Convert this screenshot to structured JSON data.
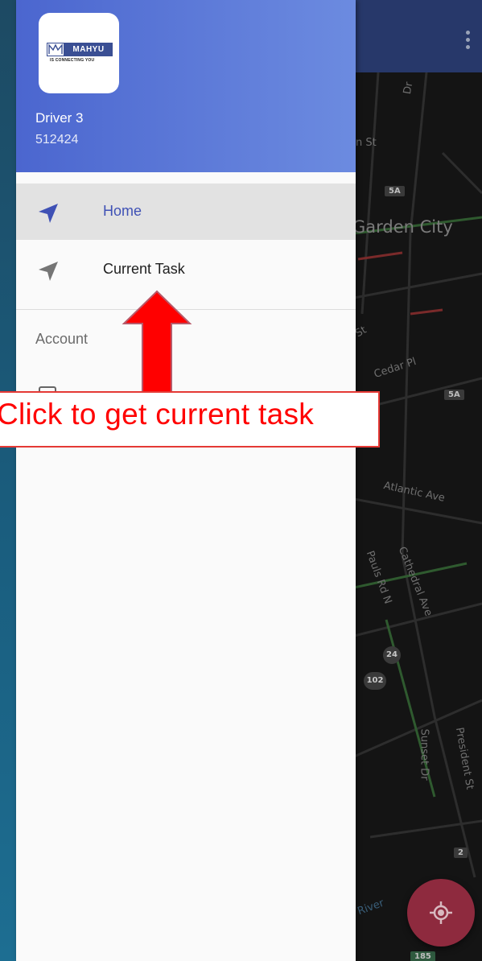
{
  "map": {
    "labels": {
      "garden_city": "Garden City",
      "cedar_pl": "Cedar Pl",
      "atlantic_ave": "Atlantic Ave",
      "st_pauls_rd": "Pauls Rd N",
      "cathedral_ave": "Cathedral Ave",
      "sunset_dr": "Sunset Dr",
      "president_st": "President St",
      "river": "River",
      "dr_fragment": "Dr",
      "n_st_fragment": "n St",
      "st_fragment": "St"
    },
    "shields": {
      "route_5a_top": "5A",
      "route_5a_mid": "5A",
      "route_24": "24",
      "route_102": "102",
      "route_2": "2",
      "route_185": "185"
    },
    "colors": {
      "appbar": "#27386a",
      "fab": "#8e2a3e"
    }
  },
  "drawer": {
    "logo_word": "MAHYU",
    "logo_tagline": "IS CONNECTING YOU",
    "driver_name": "Driver 3",
    "driver_id": "512424",
    "menu": [
      {
        "label": "Home",
        "icon": "navigation-arrow-icon",
        "active": true
      },
      {
        "label": "Current Task",
        "icon": "navigation-arrow-icon",
        "active": false
      }
    ],
    "section_label": "Account",
    "colors": {
      "header_start": "#4b66cf",
      "header_end": "#6c8be0",
      "active_text": "#3f51b5"
    }
  },
  "annotation": {
    "text": "Click to get current task",
    "color": "#ff0000"
  }
}
